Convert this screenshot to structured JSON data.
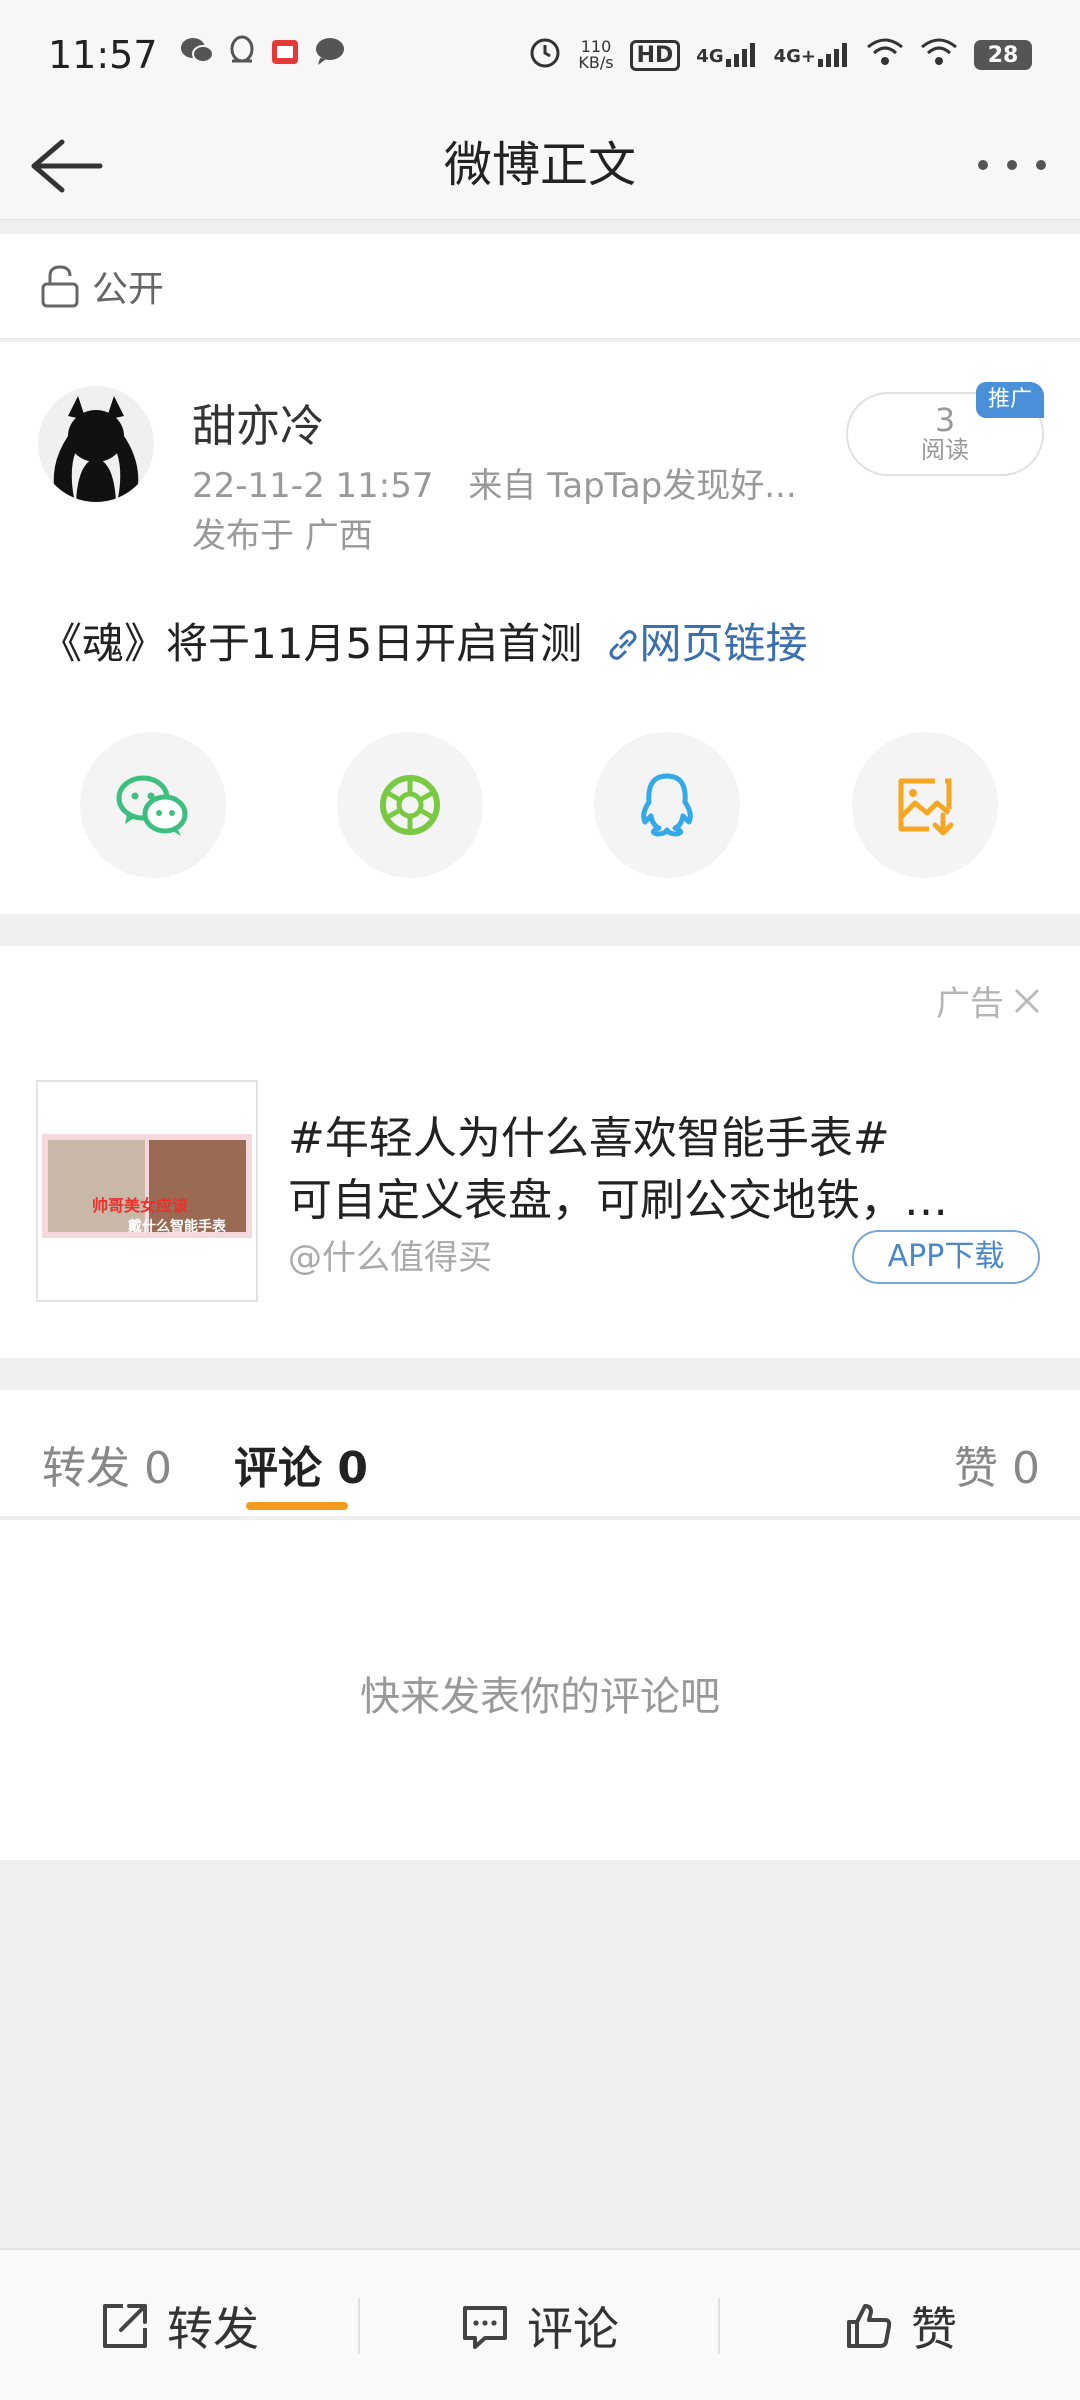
{
  "status_bar": {
    "time": "11:57",
    "net_speed_value": "110",
    "net_speed_unit": "KB/s",
    "hd_label": "HD",
    "signal1": "4G",
    "signal2": "4G+",
    "battery": "28",
    "notifications": [
      "wechat-icon",
      "qq-icon",
      "app-icon",
      "message-icon"
    ]
  },
  "header": {
    "title": "微博正文"
  },
  "visibility": {
    "label": "公开"
  },
  "post": {
    "username": "甜亦冷",
    "timestamp": "22-11-2 11:57",
    "source": "来自 TapTap发现好...",
    "location": "发布于 广西",
    "read_count": "3",
    "read_label": "阅读",
    "promo_badge": "推广",
    "text": "《魂》将于11月5日开启首测",
    "link_text": "网页链接",
    "share_targets": [
      "wechat-icon",
      "moments-icon",
      "qq-icon",
      "save-image-icon"
    ]
  },
  "ad": {
    "label": "广告",
    "title": "#年轻人为什么喜欢智能手表#",
    "description": "可自定义表盘，可刷公交地铁，…",
    "source": "@什么值得买",
    "button": "APP下载",
    "thumb_caption_1": "帅哥美女应该",
    "thumb_caption_2": "戴什么智能手表"
  },
  "tabs": {
    "repost": "转发 0",
    "comment": "评论 0",
    "like": "赞 0",
    "accent": "#f29c1f"
  },
  "comments": {
    "empty_message": "快来发表你的评论吧"
  },
  "bottom_bar": {
    "repost": "转发",
    "comment": "评论",
    "like": "赞"
  }
}
